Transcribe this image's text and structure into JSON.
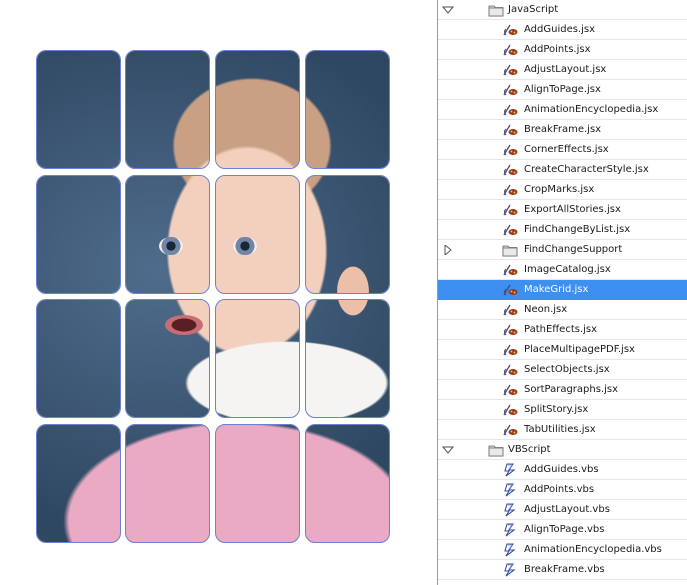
{
  "tree": {
    "js_folder": "JavaScript",
    "js_items": [
      "AddGuides.jsx",
      "AddPoints.jsx",
      "AdjustLayout.jsx",
      "AlignToPage.jsx",
      "AnimationEncyclopedia.jsx",
      "BreakFrame.jsx",
      "CornerEffects.jsx",
      "CreateCharacterStyle.jsx",
      "CropMarks.jsx",
      "ExportAllStories.jsx",
      "FindChangeByList.jsx"
    ],
    "js_subfolder": "FindChangeSupport",
    "js_items_2": [
      "ImageCatalog.jsx",
      "MakeGrid.jsx",
      "Neon.jsx",
      "PathEffects.jsx",
      "PlaceMultipagePDF.jsx",
      "SelectObjects.jsx",
      "SortParagraphs.jsx",
      "SplitStory.jsx",
      "TabUtilities.jsx"
    ],
    "selected": "MakeGrid.jsx",
    "vb_folder": "VBScript",
    "vb_items": [
      "AddGuides.vbs",
      "AddPoints.vbs",
      "AdjustLayout.vbs",
      "AlignToPage.vbs",
      "AnimationEncyclopedia.vbs",
      "BreakFrame.vbs"
    ]
  },
  "icons": {
    "folder": "folder-icon",
    "jsx": "jsx-script-icon",
    "vbs": "vbs-script-icon",
    "expanded": "disclosure-expanded-icon",
    "collapsed": "disclosure-collapsed-icon"
  },
  "colors": {
    "selection": "#3d8ff0",
    "tile_border": "#6d7fd6"
  }
}
